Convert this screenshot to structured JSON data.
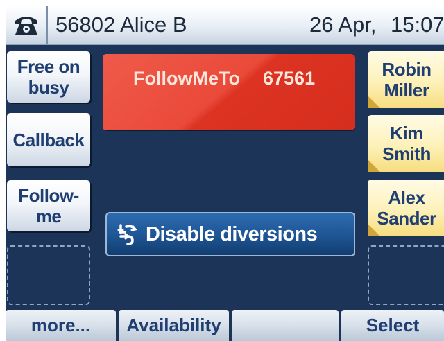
{
  "header": {
    "phone_icon": "phone-icon",
    "line": "56802 Alice B",
    "date": "26 Apr,",
    "time": "15:07"
  },
  "left_keys": [
    {
      "label_line1": "Free on",
      "label_line2": "busy"
    },
    {
      "label_line1": "Callback",
      "label_line2": ""
    },
    {
      "label_line1": "Follow-",
      "label_line2": "me"
    }
  ],
  "right_keys": [
    {
      "label_line1": "Robin",
      "label_line2": "Miller"
    },
    {
      "label_line1": "Kim",
      "label_line2": "Smith"
    },
    {
      "label_line1": "Alex",
      "label_line2": "Sander"
    }
  ],
  "call": {
    "label": "FollowMeTo",
    "number": "67561"
  },
  "diversion": {
    "icon": "diversion-icon",
    "label": "Disable diversions"
  },
  "bottom": {
    "more": "more...",
    "availability": "Availability",
    "empty": "",
    "select": "Select"
  },
  "colors": {
    "background": "#1b3458",
    "call_panel": "#e8493a",
    "accent_text": "#1f3f72",
    "contact_key": "#fdf1b8"
  }
}
